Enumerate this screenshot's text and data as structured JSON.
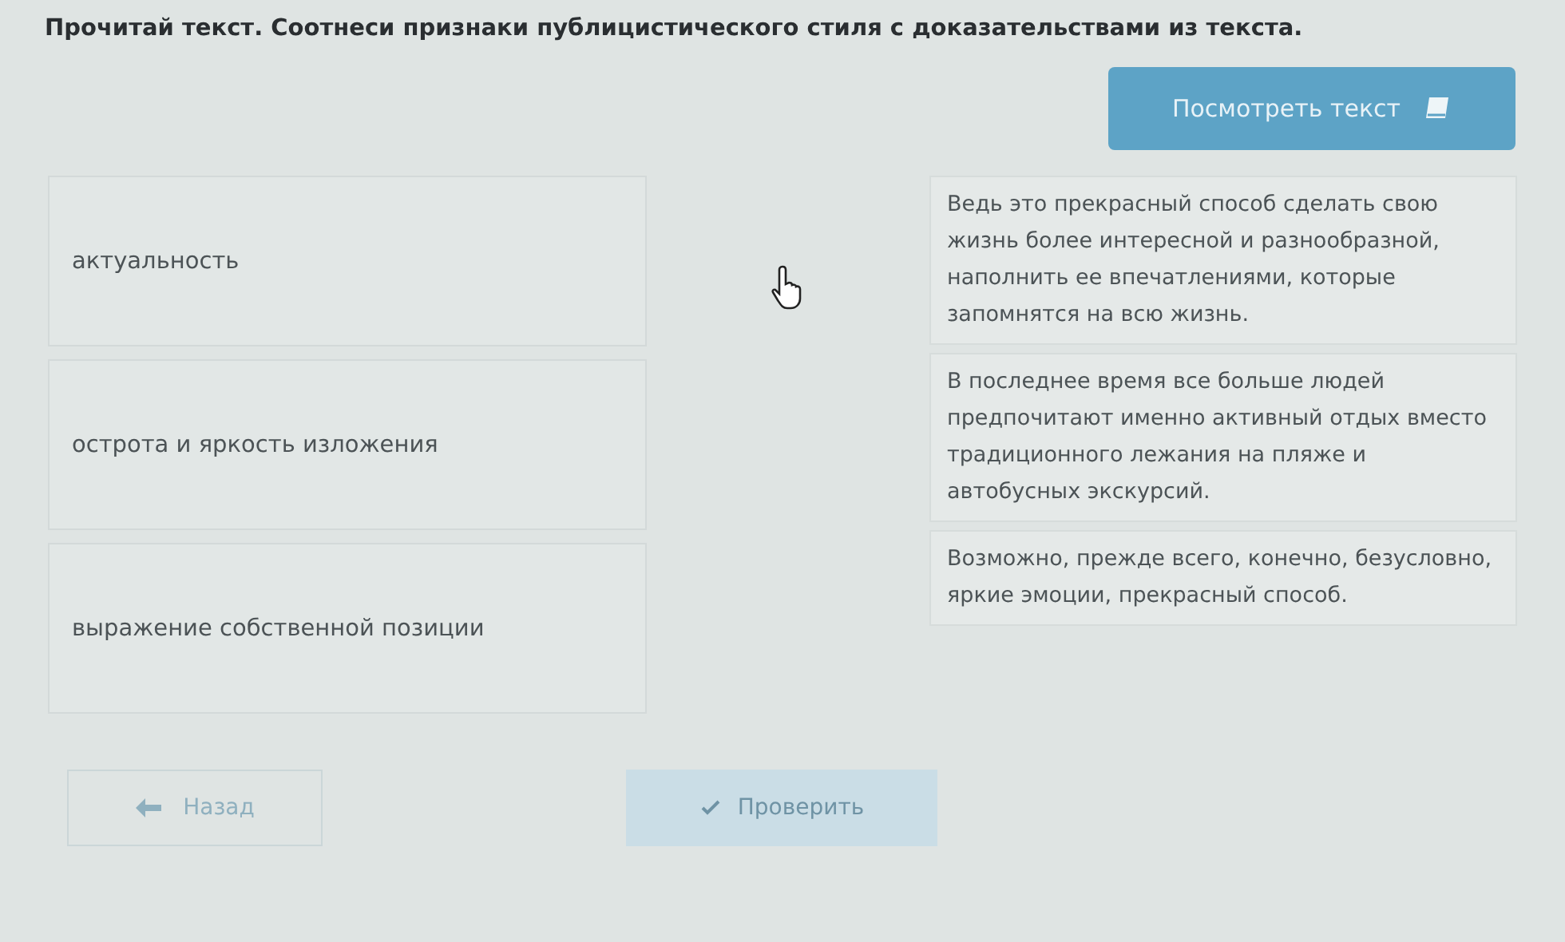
{
  "task": {
    "title": "Прочитай текст. Соотнеси признаки публицистического стиля с доказательствами из текста."
  },
  "view_text_button": {
    "label": "Посмотреть текст"
  },
  "features": [
    {
      "label": "актуальность"
    },
    {
      "label": "острота и яркость изложения"
    },
    {
      "label": "выражение собственной позиции"
    }
  ],
  "evidence": [
    {
      "text": "Ведь это прекрасный способ сделать свою жизнь более интересной и разнообразной, наполнить ее впечатлениями, которые запомнятся на всю жизнь."
    },
    {
      "text": "В последнее время все больше людей предпочитают именно активный отдых вместо традиционного лежания на пляже и автобусных экскурсий."
    },
    {
      "text": "Возможно, прежде всего, конечно, безусловно, яркие эмоции, прекрасный способ."
    }
  ],
  "nav": {
    "back": {
      "label": "Назад",
      "disabled": true
    },
    "check": {
      "label": "Проверить",
      "disabled": true
    }
  }
}
